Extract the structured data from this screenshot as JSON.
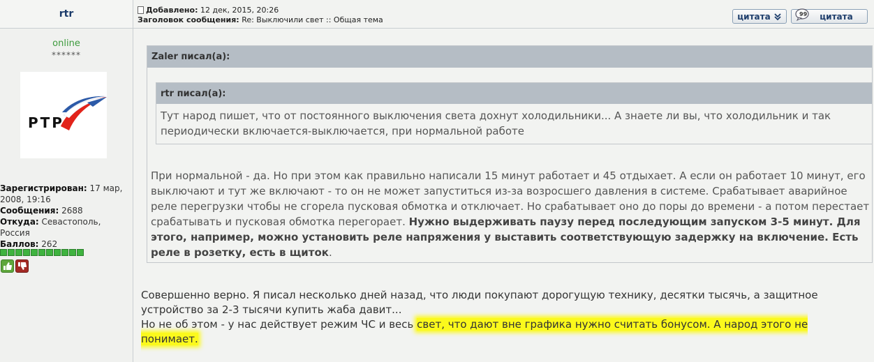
{
  "author": {
    "name": "rtr",
    "status": "online",
    "stars": "******",
    "avatar_text": "РТР",
    "registered_label": "Зарегистрирован:",
    "registered_value": "17 мар, 2008, 19:16",
    "messages_label": "Сообщения:",
    "messages_value": "2688",
    "from_label": "Откуда:",
    "from_value": "Севастополь, Россия",
    "points_label": "Баллов:",
    "points_value": "262",
    "rank_segments": 11,
    "vote_up_icon": "thumbs-up-icon",
    "vote_down_icon": "thumbs-down-icon"
  },
  "post": {
    "added_label": "Добавлено:",
    "added_value": "12 дек, 2015, 20:26",
    "subject_label": "Заголовок сообщения:",
    "subject_value": "Re: Выключили свет :: Общая тема",
    "quote_button_1": "цитата",
    "quote_button_2": "цитата",
    "outer_quote_header": "Zaler писал(а):",
    "inner_quote_header": "rtr писал(а):",
    "inner_quote_text": "Тут народ пишет, что от постоянного выключения света дохнут холодильники... А знаете ли вы, что холодильник и так периодически включается-выключается, при нормальной работе",
    "outer_quote_text_plain": "При нормальной - да. Но при этом как правильно написали 15 минут работает и 45 отдыхает. А если он работает 10 минут, его выключают и тут же включают - то он не может запуститься из-за возросшего давления в системе. Срабатывает аварийное реле перегрузки чтобы не сгорела пусковая обмотка и отключает. Но срабатывает оно до поры до времени - а потом перестает срабатывать и пусковая обмотка перегорает. ",
    "outer_quote_text_bold": "Нужно выдерживать паузу перед последующим запуском 3-5 минут. Для этого, например, можно установить реле напряжения у выставить соответствующую задержку на включение. Есть реле в розетку, есть в щиток",
    "outer_quote_text_end": ".",
    "body_line1": "Совершенно верно. Я писал несколько дней назад, что люди покупают дорогущую технику, десятки тысячь, а защитное устройство за 2-3 тысячи купить жаба давит...",
    "body_line2_plain": "Но не об этом - у нас действует режим ЧС и весь ",
    "body_line2_highlight": "свет, что дают вне графика нужно считать бонусом. А народ этого не понимает.",
    "highlight_color": "#fbf91c"
  }
}
